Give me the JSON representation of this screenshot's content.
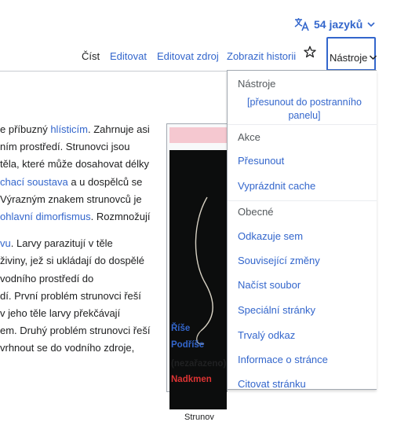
{
  "header": {
    "languages_label": "54 jazyků"
  },
  "tabs": {
    "read": "Číst",
    "edit": "Editovat",
    "edit_source": "Editovat zdroj",
    "history": "Zobrazit historii",
    "tools": "Nástroje"
  },
  "article": {
    "para1": [
      {
        "pre": "e příbuzný ",
        "link": "hlísticím",
        "post": ". Zahrnuje asi"
      },
      {
        "pre": "ním prostředí. Strunovci jsou",
        "link": "",
        "post": ""
      },
      {
        "pre": "těla, které může dosahovat délky",
        "link": "",
        "post": ""
      },
      {
        "pre": "",
        "link": "chací soustava",
        "post": " a u dospělců se"
      },
      {
        "pre": "Výrazným znakem strunovců je",
        "link": "",
        "post": ""
      },
      {
        "pre": "",
        "link": "ohlavní dimorfismus",
        "post": ". Rozmnožují"
      }
    ],
    "para2": [
      {
        "pre": "",
        "link": "vu",
        "post": ". Larvy parazitují v těle"
      },
      {
        "pre": "živiny, jež si ukládají do dospělé",
        "link": "",
        "post": ""
      },
      {
        "pre": "vodního prostředí do",
        "link": "",
        "post": ""
      },
      {
        "pre": "dí. První problém strunovci řeší",
        "link": "",
        "post": ""
      },
      {
        "pre": "v jeho těle larvy překčávají",
        "link": "",
        "post": ""
      },
      {
        "pre": "em. Druhý problém strunovci řeší",
        "link": "",
        "post": ""
      },
      {
        "pre": "vrhnout se do vodního zdroje,",
        "link": "",
        "post": ""
      }
    ]
  },
  "infobox": {
    "caption": "Strunov",
    "rows": {
      "rise": "Říše",
      "podrise": "Podříše",
      "nezarazeno": "(nezařazeno)",
      "nadkmen": "Nadkmen"
    }
  },
  "tools_menu": {
    "heading": "Nástroje",
    "move_to_sidebar": "[přesunout do postranního panelu]",
    "sections": [
      {
        "title": "Akce",
        "items": [
          "Přesunout",
          "Vyprázdnit cache"
        ]
      },
      {
        "title": "Obecné",
        "items": [
          "Odkazuje sem",
          "Související změny",
          "Načíst soubor",
          "Speciální stránky",
          "Trvalý odkaz",
          "Informace o stránce",
          "Citovat stránku"
        ]
      }
    ]
  },
  "colors": {
    "link": "#3366cc",
    "text": "#202122",
    "infobox_header": "#f5c8d0",
    "focus_border": "#3366cc"
  },
  "icons": {
    "language": "translate-icon",
    "watch": "star-icon",
    "dropdown": "chevron-down-icon"
  }
}
